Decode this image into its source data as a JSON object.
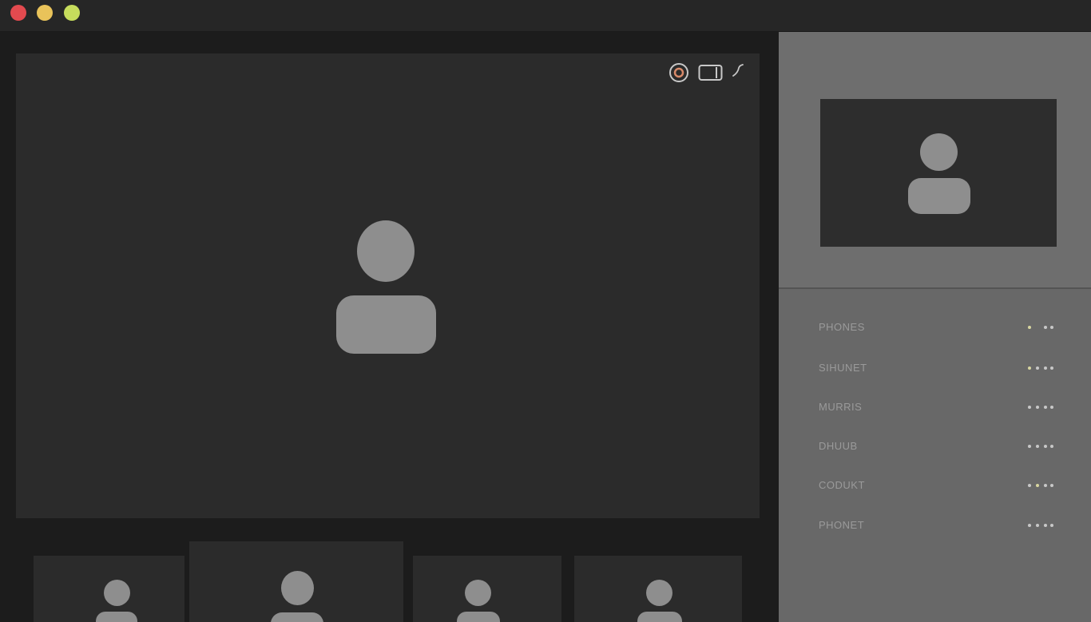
{
  "window": {
    "controls": [
      {
        "name": "close",
        "color": "#e34a4f"
      },
      {
        "name": "minimize",
        "color": "#e9c35a"
      },
      {
        "name": "maximize",
        "color": "#c6dc5c"
      }
    ]
  },
  "stage": {
    "controls": [
      {
        "icon": "record-icon"
      },
      {
        "icon": "screen-share-icon"
      },
      {
        "icon": "expand-icon"
      }
    ]
  },
  "participants": [
    {
      "name": "PHONES",
      "status": "online"
    },
    {
      "name": "SIHUNET",
      "status": "online"
    },
    {
      "name": "MURRIS",
      "status": "online"
    },
    {
      "name": "DHUUB",
      "status": "online"
    },
    {
      "name": "CODUKT",
      "status": "online"
    },
    {
      "name": "PHONET",
      "status": "online"
    }
  ],
  "colors": {
    "accent_dot": "#d8d6a0",
    "avatar": "#8e8e8e"
  }
}
